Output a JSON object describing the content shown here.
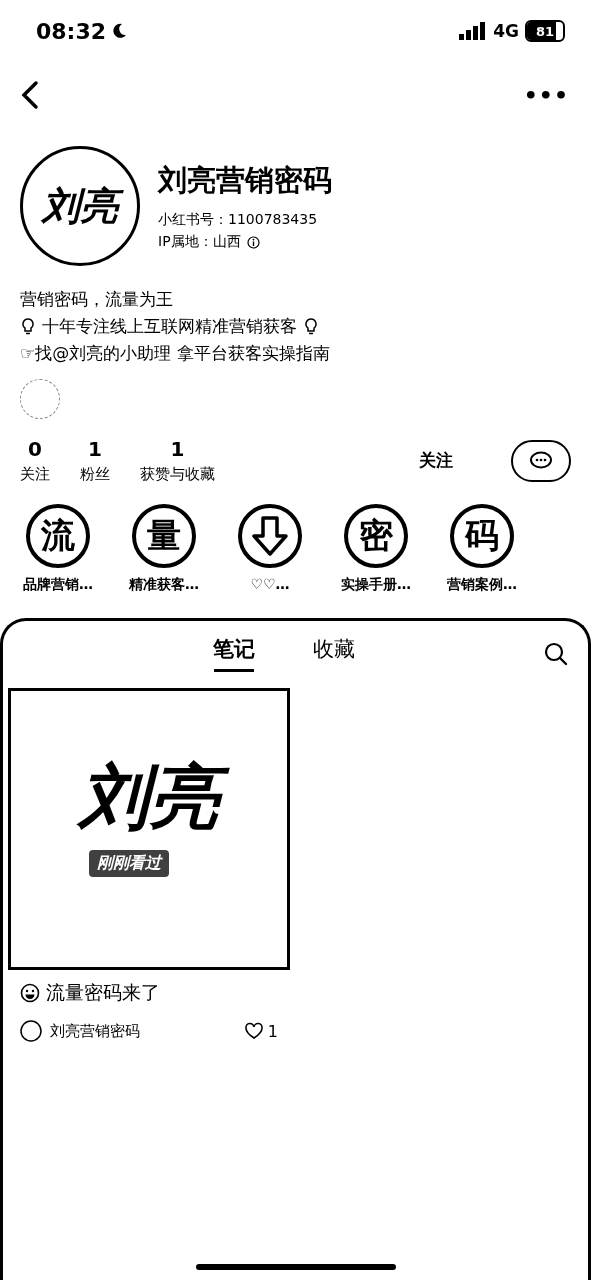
{
  "status_bar": {
    "time": "08:32",
    "network": "4G",
    "battery": "81",
    "level": 0.81
  },
  "nav": {
    "more": "•••"
  },
  "profile": {
    "avatar_text": "刘亮",
    "name": "刘亮营销密码",
    "id": "小红书号：1100783435",
    "ip": "IP属地：山西"
  },
  "bio": [
    {
      "kind": "plain",
      "text": "营销密码，流量为王"
    },
    {
      "kind": "bulbs",
      "text": "十年专注线上互联网精准营销获客"
    },
    {
      "kind": "plain",
      "text": "☞找@刘亮的小助理 拿平台获客实操指南"
    }
  ],
  "stats": [
    {
      "value": "0",
      "label": "关注"
    },
    {
      "value": "1",
      "label": "粉丝"
    },
    {
      "value": "1",
      "label": "获赞与收藏"
    }
  ],
  "follow_button": "关注",
  "highlights": [
    {
      "kind": "text",
      "glyph": "流",
      "label": "品牌营销…"
    },
    {
      "kind": "text",
      "glyph": "量",
      "label": "精准获客…"
    },
    {
      "kind": "icon",
      "label": "♡♡…"
    },
    {
      "kind": "text",
      "glyph": "密",
      "label": "实操手册…"
    },
    {
      "kind": "text",
      "glyph": "码",
      "label": "营销案例…"
    }
  ],
  "tabs": [
    {
      "label": "笔记",
      "selected": true
    },
    {
      "label": "收藏",
      "selected": false
    }
  ],
  "notes": [
    {
      "cover_text": "刘亮",
      "badge": "刚刚看过",
      "title": "流量密码来了",
      "author": "刘亮营销密码",
      "likes": "1",
      "liked": false
    }
  ]
}
